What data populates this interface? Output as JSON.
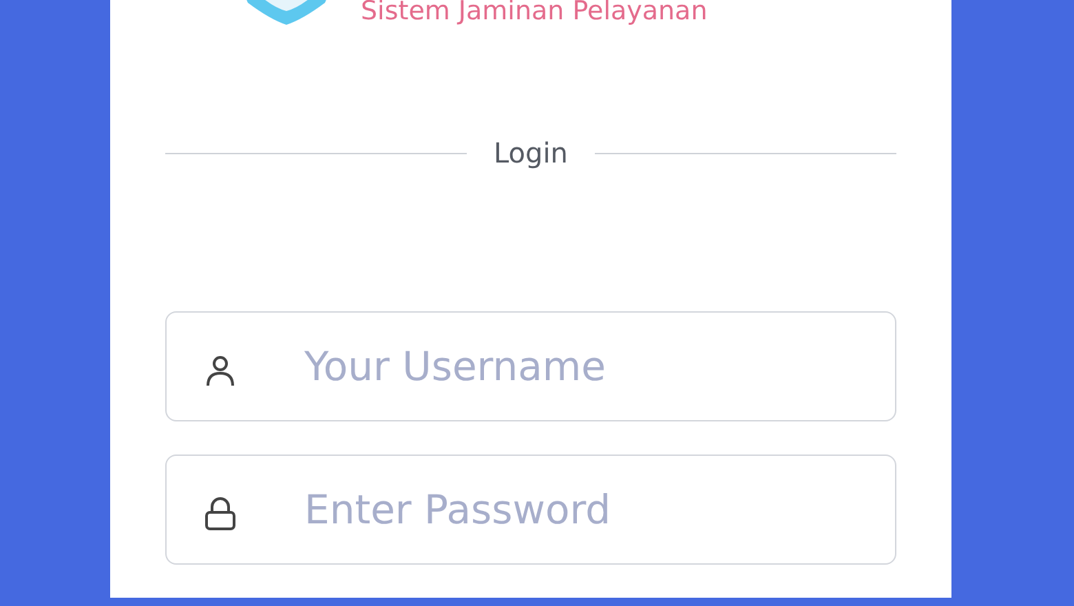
{
  "app_title": "Sistem Jaminan Pelayanan",
  "divider_label": "Login",
  "fields": [
    {
      "kind": "user",
      "placeholder": "Your Username"
    },
    {
      "kind": "password",
      "placeholder": "Enter Password"
    }
  ]
}
